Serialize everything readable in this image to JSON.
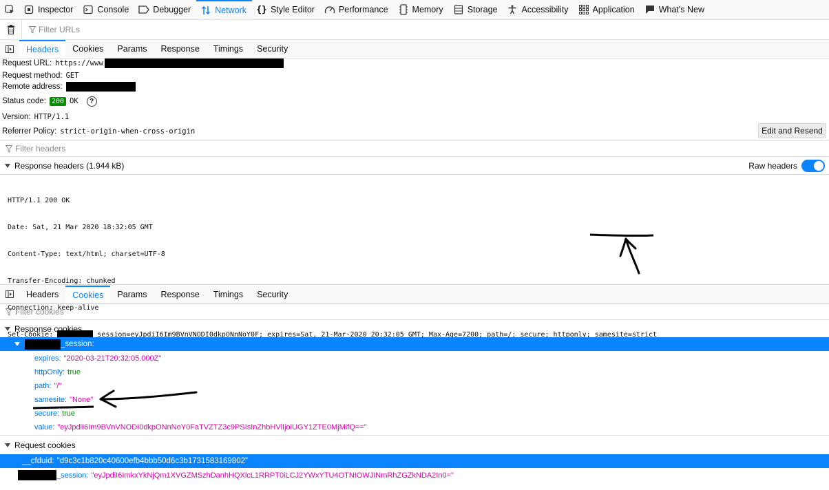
{
  "toolbar": {
    "tabs": [
      {
        "label": "Inspector",
        "icon": "inspector-icon"
      },
      {
        "label": "Console",
        "icon": "console-icon"
      },
      {
        "label": "Debugger",
        "icon": "debugger-icon"
      },
      {
        "label": "Network",
        "icon": "network-icon",
        "active": true
      },
      {
        "label": "Style Editor",
        "icon": "braces-icon"
      },
      {
        "label": "Performance",
        "icon": "gauge-icon"
      },
      {
        "label": "Memory",
        "icon": "memory-icon"
      },
      {
        "label": "Storage",
        "icon": "storage-icon"
      },
      {
        "label": "Accessibility",
        "icon": "accessibility-icon"
      },
      {
        "label": "Application",
        "icon": "grid-icon"
      },
      {
        "label": "What's New",
        "icon": "whats-new-icon"
      }
    ]
  },
  "filter_urls": {
    "placeholder": "Filter URLs"
  },
  "headers_panel": {
    "tabs": [
      "Headers",
      "Cookies",
      "Params",
      "Response",
      "Timings",
      "Security"
    ],
    "active_tab": "Headers",
    "request_url_label": "Request URL:",
    "request_url_value": "https://www",
    "request_method_label": "Request method:",
    "request_method_value": "GET",
    "remote_address_label": "Remote address:",
    "status_code_label": "Status code:",
    "status_code": "200",
    "status_text": "OK",
    "version_label": "Version:",
    "version_value": "HTTP/1.1",
    "referrer_policy_label": "Referrer Policy:",
    "referrer_policy_value": "strict-origin-when-cross-origin",
    "edit_resend_label": "Edit and Resend",
    "filter_headers_placeholder": "Filter headers",
    "response_headers_title": "Response headers (1.944 kB)",
    "raw_headers_label": "Raw headers",
    "raw_lines": [
      "HTTP/1.1 200 OK",
      "Date: Sat, 21 Mar 2020 18:32:05 GMT",
      "Content-Type: text/html; charset=UTF-8",
      "Transfer-Encoding: chunked",
      "Connection: keep-alive"
    ],
    "set_cookie_label": "Set-Cookie:",
    "set_cookie_value": "_session=eyJpdiI6Im9BVnVNODI0dkpONnNoY0F; expires=Sat, 21-Mar-2020 20:32:05 GMT; Max-Age=7200; path=/; secure; httponly;",
    "set_cookie_samesite": "samesite=strict"
  },
  "cookies_panel": {
    "tabs": [
      "Headers",
      "Cookies",
      "Params",
      "Response",
      "Timings",
      "Security"
    ],
    "active_tab": "Cookies",
    "filter_cookies_placeholder": "Filter cookies",
    "response_cookies_title": "Response cookies",
    "session_label": "_session:",
    "props": [
      {
        "key": "expires:",
        "value": "\"2020-03-21T20:32:05.000Z\"",
        "kind": "str"
      },
      {
        "key": "httpOnly:",
        "value": "true",
        "kind": "bool"
      },
      {
        "key": "path:",
        "value": "\"/\"",
        "kind": "str"
      },
      {
        "key": "samesite:",
        "value": "\"None\"",
        "kind": "str"
      },
      {
        "key": "secure:",
        "value": "true",
        "kind": "bool"
      },
      {
        "key": "value:",
        "value": "\"eyJpdiI6Im9BVnVNODI0dkpONnNoY0FaTVZTZ3c9PSIsInZhbHVlIjoiUGY1ZTE0MjMifQ==\"",
        "kind": "str"
      }
    ],
    "request_cookies_title": "Request cookies",
    "cfduid_key": "__cfduid:",
    "cfduid_value": "\"d9c3c1b820c40600efb4bbb50d6c3b1731583169802\"",
    "req_session_key": "_session:",
    "req_session_value": "\"eyJpdiI6ImkxYkNjQm1XVGZMSzhDanhHQXlcL1RRPT0iLCJ2YWxYTU4OTNIOWJINmRhZGZkNDA2In0=\""
  }
}
